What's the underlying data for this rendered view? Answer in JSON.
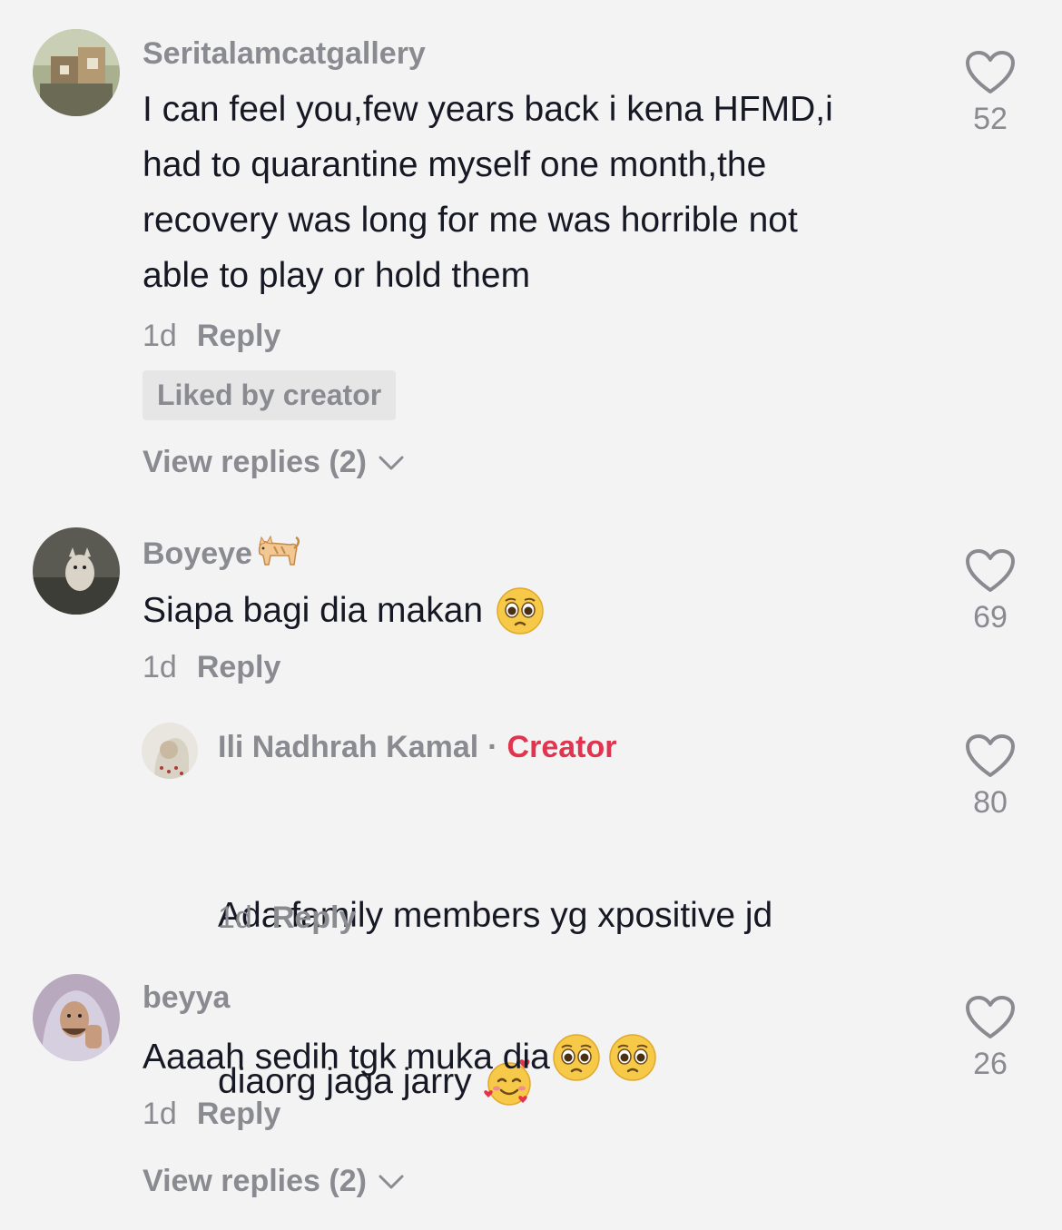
{
  "comments": [
    {
      "username": "Seritalamcatgallery",
      "text": "I can feel you,few years back i kena HFMD,i\nhad to quarantine myself one month,the\nrecovery was long for me was horrible not\nable to play or hold them",
      "time": "1d",
      "reply_label": "Reply",
      "badge": "Liked by creator",
      "view_replies": "View replies (2)",
      "likes": "52"
    },
    {
      "username": "Boyeye",
      "text": "Siapa bagi dia makan",
      "time": "1d",
      "reply_label": "Reply",
      "likes": "69"
    },
    {
      "username": "Ili Nadhrah Kamal",
      "creator_label": "Creator",
      "text_line1": "Ada family members yg xpositive jd",
      "text_line2": "diaorg jaga jarry",
      "time": "1d",
      "reply_label": "Reply",
      "likes": "80"
    },
    {
      "username": "beyya",
      "text": "Aaaah sedih tgk muka dia",
      "time": "1d",
      "reply_label": "Reply",
      "view_replies": "View replies (2)",
      "likes": "26"
    }
  ],
  "colors": {
    "background": "#f4f3f4",
    "text": "#161823",
    "secondary": "#8a8b91",
    "creator": "#e0344f"
  },
  "icons": [
    "heart-icon",
    "chevron-down-icon",
    "pleading-face-emoji",
    "smiling-face-with-hearts-emoji",
    "cat-emoji"
  ]
}
